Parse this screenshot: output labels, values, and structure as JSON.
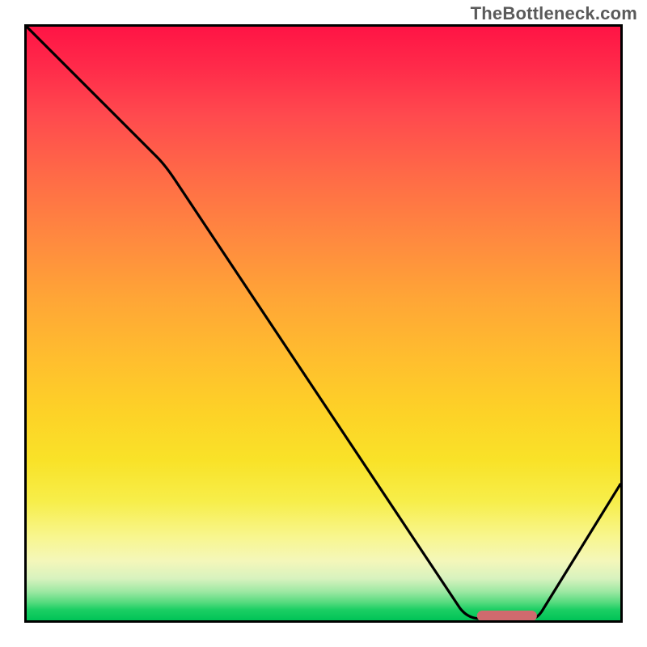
{
  "watermark": "TheBottleneck.com",
  "chart_data": {
    "type": "line",
    "title": "",
    "xlabel": "",
    "ylabel": "",
    "xlim": [
      0,
      100
    ],
    "ylim": [
      0,
      100
    ],
    "series": [
      {
        "name": "bottleneck-curve",
        "x": [
          0,
          22,
          24,
          73,
          78,
          85,
          100
        ],
        "y": [
          100,
          78,
          76,
          2,
          0,
          0,
          23
        ]
      }
    ],
    "marker": {
      "name": "optimal-zone",
      "x_start": 76,
      "x_end": 86,
      "y": 0.8,
      "color": "#d06a6e"
    },
    "background_gradient": {
      "top_color": "#ff1445",
      "mid_color": "#fdd227",
      "bottom_color": "#00c357"
    }
  }
}
